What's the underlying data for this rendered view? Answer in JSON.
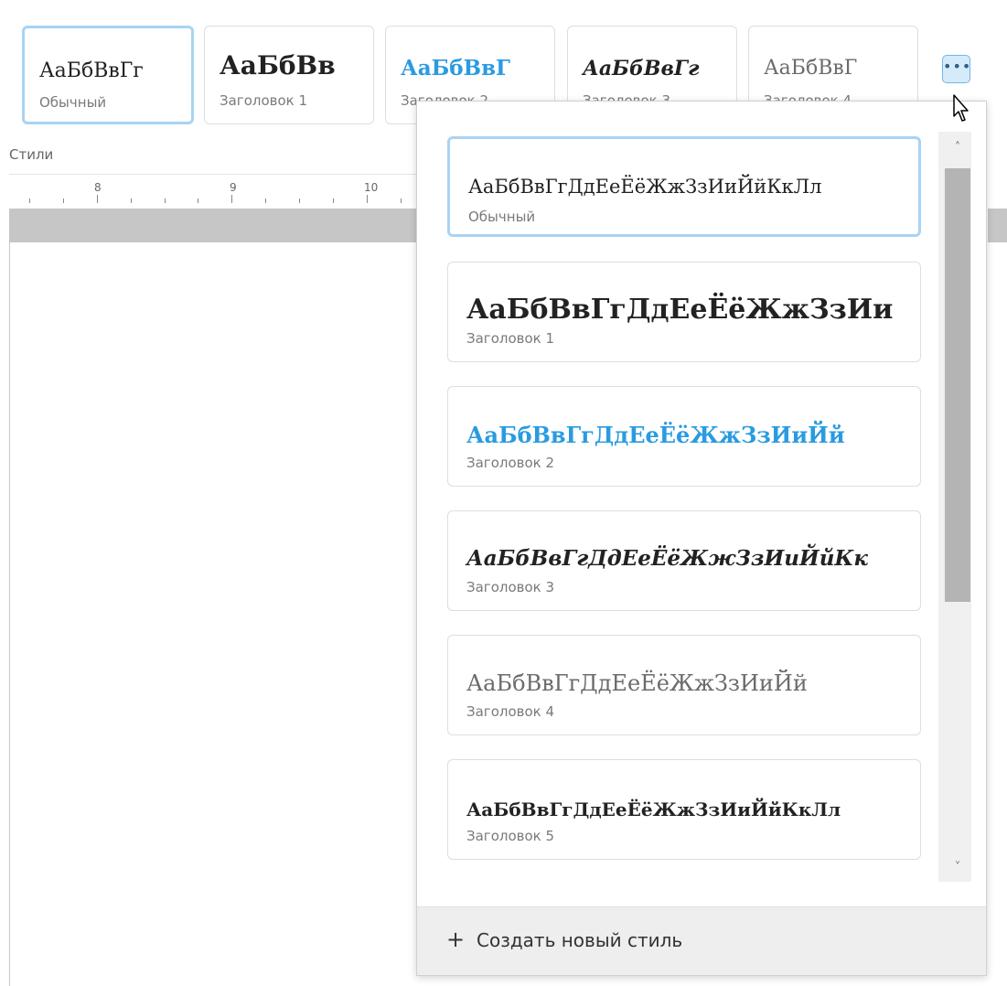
{
  "ribbon": {
    "label": "Стили",
    "more_label": "•••",
    "styles": [
      {
        "sample": "АаБбВвГг",
        "name": "Обычный"
      },
      {
        "sample": "АаБбВв",
        "name": "Заголовок 1"
      },
      {
        "sample": "АаБбВвГ",
        "name": "Заголовок 2"
      },
      {
        "sample": "АаБбВвГг",
        "name": "Заголовок 3"
      },
      {
        "sample": "АаБбВвГ",
        "name": "Заголовок 4"
      }
    ]
  },
  "ruler": {
    "numbers": [
      "8",
      "9",
      "10"
    ]
  },
  "dropdown": {
    "styles": [
      {
        "sample": "АаБбВвГгДдЕеЁёЖжЗзИиЙйКкЛл",
        "name": "Обычный"
      },
      {
        "sample": "АаБбВвГгДдЕеЁёЖжЗзИи",
        "name": "Заголовок 1"
      },
      {
        "sample": "АаБбВвГгДдЕеЁёЖжЗзИиЙй",
        "name": "Заголовок 2"
      },
      {
        "sample": "АаБбВвГгДдЕеЁёЖжЗзИиЙйКк",
        "name": "Заголовок 3"
      },
      {
        "sample": "АаБбВвГгДдЕеЁёЖжЗзИиЙй",
        "name": "Заголовок 4"
      },
      {
        "sample": "АаБбВвГгДдЕеЁёЖжЗзИиЙйКкЛл",
        "name": "Заголовок 5"
      }
    ],
    "scroll_up": "˄",
    "scroll_down": "˅",
    "create_plus": "+",
    "create_label": "Создать новый стиль"
  },
  "colors": {
    "accent": "#2a9be0",
    "selected_border": "#a9d3f3",
    "heading4_gray": "#6b6b6b"
  }
}
